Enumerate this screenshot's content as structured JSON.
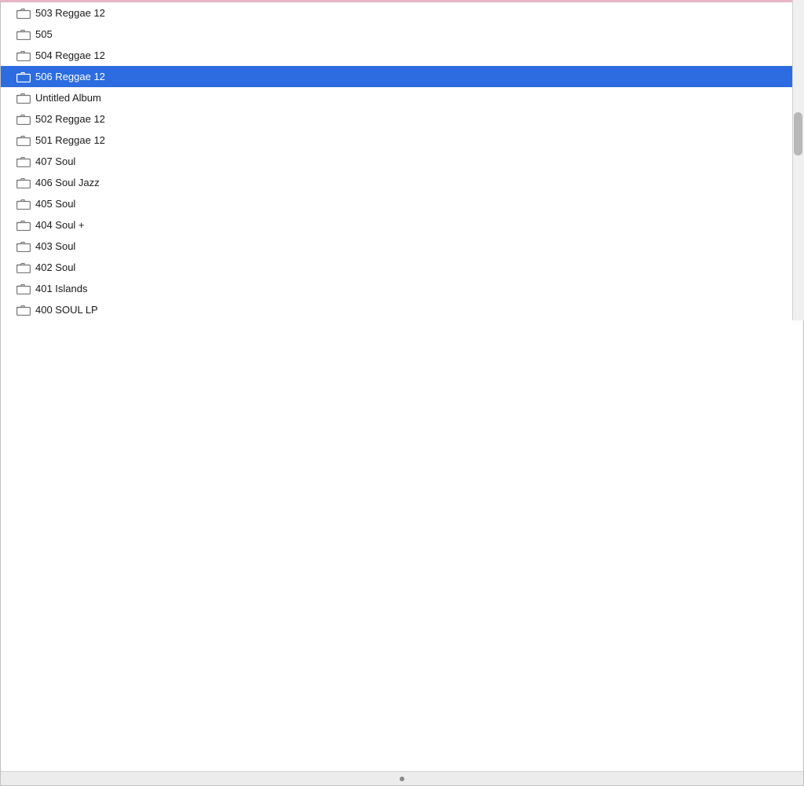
{
  "colors": {
    "selected_bg": "#2c6ce0",
    "selected_text": "#ffffff",
    "normal_text": "#1a1a1a",
    "icon_normal": "#888888",
    "icon_selected": "#ffffff",
    "window_border_top": "#e8b4c8"
  },
  "items": [
    {
      "id": "item-503-reggae12",
      "label": "503 Reggae 12",
      "selected": false
    },
    {
      "id": "item-505",
      "label": "505",
      "selected": false
    },
    {
      "id": "item-504-reggae12",
      "label": "504 Reggae 12",
      "selected": false
    },
    {
      "id": "item-506-reggae12",
      "label": "506 Reggae 12",
      "selected": true
    },
    {
      "id": "item-untitled-album",
      "label": "Untitled Album",
      "selected": false
    },
    {
      "id": "item-502-reggae12",
      "label": "502 Reggae 12",
      "selected": false
    },
    {
      "id": "item-501-reggae12",
      "label": "501 Reggae 12",
      "selected": false
    },
    {
      "id": "item-407-soul",
      "label": "407 Soul",
      "selected": false
    },
    {
      "id": "item-406-soul-jazz",
      "label": "406 Soul Jazz",
      "selected": false
    },
    {
      "id": "item-405-soul",
      "label": "405 Soul",
      "selected": false
    },
    {
      "id": "item-404-soul-plus",
      "label": "404 Soul +",
      "selected": false
    },
    {
      "id": "item-403-soul",
      "label": "403 Soul",
      "selected": false
    },
    {
      "id": "item-402-soul",
      "label": "402 Soul",
      "selected": false
    },
    {
      "id": "item-401-islands",
      "label": "401 Islands",
      "selected": false
    },
    {
      "id": "item-400-soul-lp",
      "label": "400 SOUL LP",
      "selected": false
    }
  ]
}
